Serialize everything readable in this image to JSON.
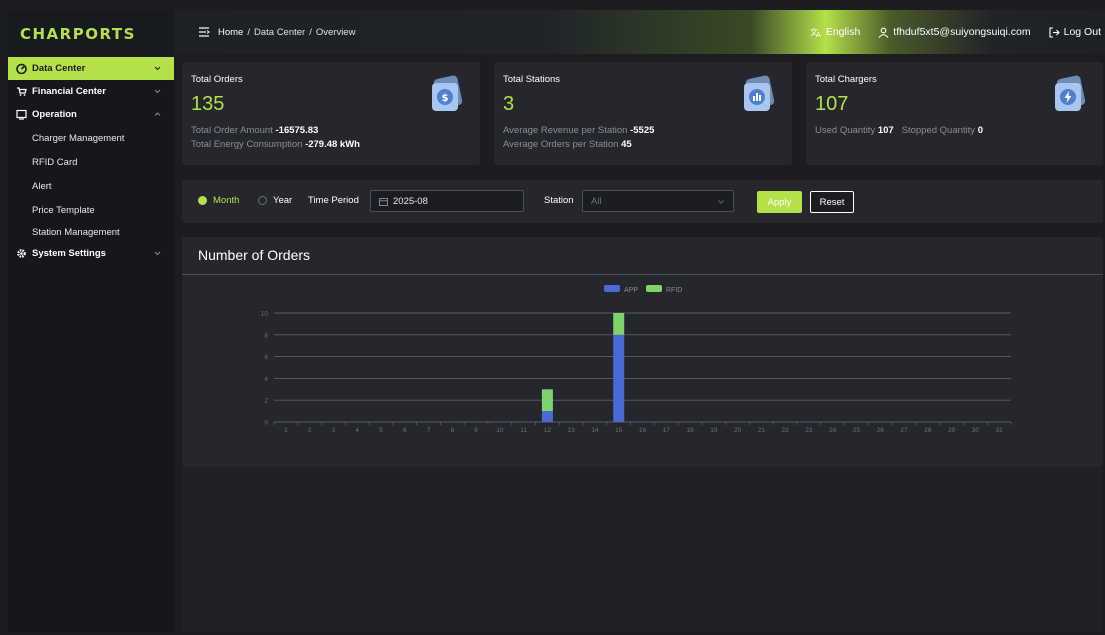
{
  "brand": {
    "logo": "CHARPORTS"
  },
  "sidebar": {
    "items": [
      {
        "label": "Data Center",
        "icon": "dashboard-icon",
        "active": true
      },
      {
        "label": "Financial Center",
        "icon": "cart-icon"
      },
      {
        "label": "Operation",
        "icon": "monitor-icon",
        "expanded": true,
        "children": [
          "Charger Management",
          "RFID Card",
          "Alert",
          "Price Template",
          "Station Management"
        ]
      },
      {
        "label": "System Settings",
        "icon": "gear-icon"
      }
    ]
  },
  "header": {
    "breadcrumb": [
      "Home",
      "Data Center",
      "Overview"
    ],
    "language": "English",
    "user": "tfhduf5xt5@suiyongsuiqi.com",
    "logout": "Log Out"
  },
  "cards": [
    {
      "title": "Total Orders",
      "value": "135",
      "lines": [
        {
          "label": "Total Order Amount",
          "value": "-16575.83"
        },
        {
          "label": "Total Energy Consumption",
          "value": "-279.48 kWh"
        }
      ],
      "icon": "dollar-icon"
    },
    {
      "title": "Total Stations",
      "value": "3",
      "lines": [
        {
          "label": "Average Revenue per Station",
          "value": "-5525"
        },
        {
          "label": "Average Orders per Station",
          "value": "45"
        }
      ],
      "icon": "bar-chart-icon"
    },
    {
      "title": "Total Chargers",
      "value": "107",
      "used_label": "Used Quantity",
      "used_value": "107",
      "stopped_label": "Stopped Quantity",
      "stopped_value": "0",
      "icon": "lightning-icon"
    }
  ],
  "filters": {
    "month": "Month",
    "year": "Year",
    "selected": "Month",
    "time_period_label": "Time Period",
    "time_period_value": "2025-08",
    "station_label": "Station",
    "station_placeholder": "All",
    "apply": "Apply",
    "reset": "Reset"
  },
  "colors": {
    "accent": "#b4e04a",
    "app": "#4a6ad8",
    "rfid": "#7ed36a"
  },
  "chart_title": "Number of Orders",
  "chart_data": {
    "type": "bar",
    "stacked": true,
    "categories": [
      "1",
      "2",
      "3",
      "4",
      "5",
      "6",
      "7",
      "8",
      "9",
      "10",
      "11",
      "12",
      "13",
      "14",
      "15",
      "16",
      "17",
      "18",
      "19",
      "20",
      "21",
      "22",
      "23",
      "24",
      "25",
      "26",
      "27",
      "28",
      "29",
      "30",
      "31"
    ],
    "series": [
      {
        "name": "APP",
        "values": [
          0,
          0,
          0,
          0,
          0,
          0,
          0,
          0,
          0,
          0,
          0,
          1,
          0,
          0,
          8,
          0,
          0,
          0,
          0,
          0,
          0,
          0,
          0,
          0,
          0,
          0,
          0,
          0,
          0,
          0,
          0
        ]
      },
      {
        "name": "RFID",
        "values": [
          0,
          0,
          0,
          0,
          0,
          0,
          0,
          0,
          0,
          0,
          0,
          2,
          0,
          0,
          2,
          0,
          0,
          0,
          0,
          0,
          0,
          0,
          0,
          0,
          0,
          0,
          0,
          0,
          0,
          0,
          0
        ]
      }
    ],
    "extra_note": "",
    "ylim": [
      0,
      10
    ],
    "yticks": [
      0,
      2,
      4,
      6,
      8,
      10
    ],
    "legend": "top-center",
    "grid": true
  }
}
